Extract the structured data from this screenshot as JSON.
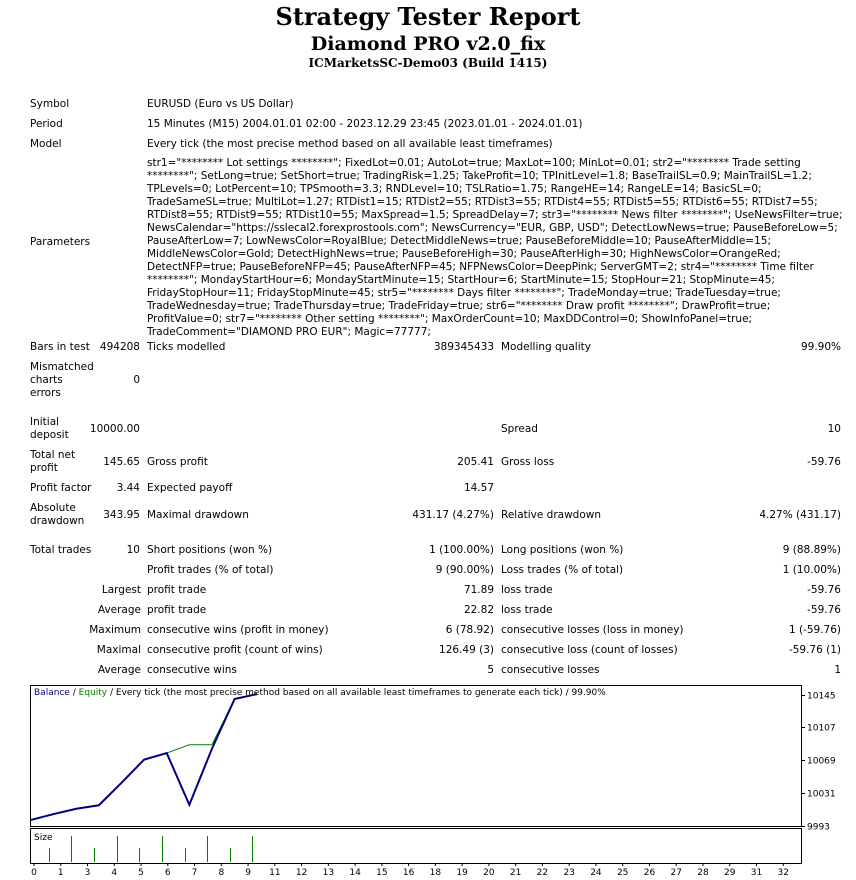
{
  "header": {
    "title": "Strategy Tester Report",
    "subtitle": "Diamond PRO v2.0_fix",
    "server": "ICMarketsSC-Demo03 (Build 1415)"
  },
  "info": {
    "symbol_label": "Symbol",
    "symbol_value": "EURUSD (Euro vs US Dollar)",
    "period_label": "Period",
    "period_value": "15 Minutes (M15) 2004.01.01 02:00 - 2023.12.29 23:45 (2023.01.01 - 2024.01.01)",
    "model_label": "Model",
    "model_value": "Every tick (the most precise method based on all available least timeframes)",
    "parameters_label": "Parameters",
    "parameters_value": "str1=\"******** Lot settings ********\"; FixedLot=0.01; AutoLot=true; MaxLot=100; MinLot=0.01; str2=\"******** Trade setting ********\"; SetLong=true; SetShort=true; TradingRisk=1.25; TakeProfit=10; TPInitLevel=1.8; BaseTrailSL=0.9; MainTrailSL=1.2; TPLevels=0; LotPercent=10; TPSmooth=3.3; RNDLevel=10; TSLRatio=1.75; RangeHE=14; RangeLE=14; BasicSL=0; TradeSameSL=true; MultiLot=1.27; RTDist1=15; RTDist2=55; RTDist3=55; RTDist4=55; RTDist5=55; RTDist6=55; RTDist7=55; RTDist8=55; RTDist9=55; RTDist10=55; MaxSpread=1.5; SpreadDelay=7; str3=\"******** News filter ********\"; UseNewsFilter=true; NewsCalendar=\"https://sslecal2.forexprostools.com\"; NewsCurrency=\"EUR, GBP, USD\"; DetectLowNews=true; PauseBeforeLow=5; PauseAfterLow=7; LowNewsColor=RoyalBlue; DetectMiddleNews=true; PauseBeforeMiddle=10; PauseAfterMiddle=15; MiddleNewsColor=Gold; DetectHighNews=true; PauseBeforeHigh=30; PauseAfterHigh=30; HighNewsColor=OrangeRed; DetectNFP=true; PauseBeforeNFP=45; PauseAfterNFP=45; NFPNewsColor=DeepPink; ServerGMT=2; str4=\"******** Time filter ********\"; MondayStartHour=6; MondayStartMinute=15; StartHour=6; StartMinute=15; StopHour=21; StopMinute=45; FridayStopHour=11; FridayStopMinute=45; str5=\"******** Days filter ********\"; TradeMonday=true; TradeTuesday=true; TradeWednesday=true; TradeThursday=true; TradeFriday=true; str6=\"******** Draw profit ********\"; DrawProfit=true; ProfitValue=0; str7=\"******** Other setting ********\"; MaxOrderCount=10; MaxDDControl=0; ShowInfoPanel=true; TradeComment=\"DIAMOND PRO EUR\"; Magic=77777;"
  },
  "stats": {
    "bars_label": "Bars in test",
    "bars_value": "494208",
    "ticks_label": "Ticks modelled",
    "ticks_value": "389345433",
    "quality_label": "Modelling quality",
    "quality_value": "99.90%",
    "mismatched_label_1": "Mismatched",
    "mismatched_label_2": "charts",
    "mismatched_label_3": "errors",
    "mismatched_value": "0",
    "initial_label_1": "Initial",
    "initial_label_2": "deposit",
    "initial_value": "10000.00",
    "spread_label": "Spread",
    "spread_value": "10",
    "netprofit_label_1": "Total net",
    "netprofit_label_2": "profit",
    "netprofit_value": "145.65",
    "grossprofit_label": "Gross profit",
    "grossprofit_value": "205.41",
    "grossloss_label": "Gross loss",
    "grossloss_value": "-59.76",
    "pf_label": "Profit factor",
    "pf_value": "3.44",
    "expected_label": "Expected payoff",
    "expected_value": "14.57",
    "absdd_label_1": "Absolute",
    "absdd_label_2": "drawdown",
    "absdd_value": "343.95",
    "maxdd_label": "Maximal drawdown",
    "maxdd_value": "431.17 (4.27%)",
    "reldd_label": "Relative drawdown",
    "reldd_value": "4.27% (431.17)",
    "trades_label": "Total trades",
    "trades_value": "10",
    "short_label": "Short positions (won %)",
    "short_value": "1 (100.00%)",
    "long_label": "Long positions (won %)",
    "long_value": "9 (88.89%)",
    "profit_trades_label": "Profit trades (% of total)",
    "profit_trades_value": "9 (90.00%)",
    "loss_trades_label": "Loss trades (% of total)",
    "loss_trades_value": "1 (10.00%)",
    "largest_label": "Largest",
    "largest_profit_label": "profit trade",
    "largest_profit_value": "71.89",
    "largest_loss_label": "loss trade",
    "largest_loss_value": "-59.76",
    "average_label": "Average",
    "average_profit_label": "profit trade",
    "average_profit_value": "22.82",
    "average_loss_label": "loss trade",
    "average_loss_value": "-59.76",
    "maximum_label": "Maximum",
    "max_cons_wins_label": "consecutive wins (profit in money)",
    "max_cons_wins_value": "6 (78.92)",
    "max_cons_losses_label": "consecutive losses (loss in money)",
    "max_cons_losses_value": "1 (-59.76)",
    "maximal_label": "Maximal",
    "maxl_cons_profit_label": "consecutive profit (count of wins)",
    "maxl_cons_profit_value": "126.49 (3)",
    "maxl_cons_loss_label": "consecutive loss (count of losses)",
    "maxl_cons_loss_value": "-59.76 (1)",
    "average2_label": "Average",
    "avg_cons_wins_label": "consecutive wins",
    "avg_cons_wins_value": "5",
    "avg_cons_losses_label": "consecutive losses",
    "avg_cons_losses_value": "1"
  },
  "chart_data": {
    "type": "line",
    "legend_balance": "Balance",
    "legend_sep": " / ",
    "legend_equity": "Equity",
    "legend_rest": " / Every tick (the most precise method based on all available least timeframes to generate each tick) / 99.90%",
    "size_label": "Size",
    "x_ticks": [
      "0",
      "1",
      "3",
      "4",
      "5",
      "6",
      "7",
      "8",
      "9",
      "11",
      "12",
      "13",
      "14",
      "15",
      "16",
      "18",
      "19",
      "20",
      "21",
      "22",
      "23",
      "24",
      "25",
      "26",
      "27",
      "28",
      "29",
      "31",
      "32"
    ],
    "y_ticks": [
      "10145",
      "10107",
      "10069",
      "10031",
      "9993"
    ],
    "ylim": [
      9993,
      10155
    ],
    "xlim": [
      0,
      32
    ],
    "colors": {
      "balance": "#000080",
      "equity": "#008000",
      "size": "#008000",
      "grid": "#000000"
    },
    "series": [
      {
        "name": "Balance",
        "x": [
          0,
          1,
          2,
          3,
          4,
          5,
          6,
          7,
          8,
          9,
          10
        ],
        "y": [
          10000.0,
          10006.8,
          10013.0,
          10017.0,
          10043.0,
          10069.8,
          10077.4,
          10017.6,
          10082.4,
          10139.9,
          10145.7
        ]
      },
      {
        "name": "Equity",
        "x": [
          0,
          1,
          2,
          3,
          4,
          5,
          6,
          7,
          8,
          9,
          10
        ],
        "y": [
          10000.0,
          10006.8,
          10013.0,
          10017.0,
          10043.0,
          10069.8,
          10077.4,
          10087.0,
          10087.0,
          10139.9,
          10145.7
        ]
      }
    ],
    "size_bars": [
      1,
      2,
      3,
      4,
      5,
      6,
      7,
      8,
      9,
      10
    ]
  }
}
